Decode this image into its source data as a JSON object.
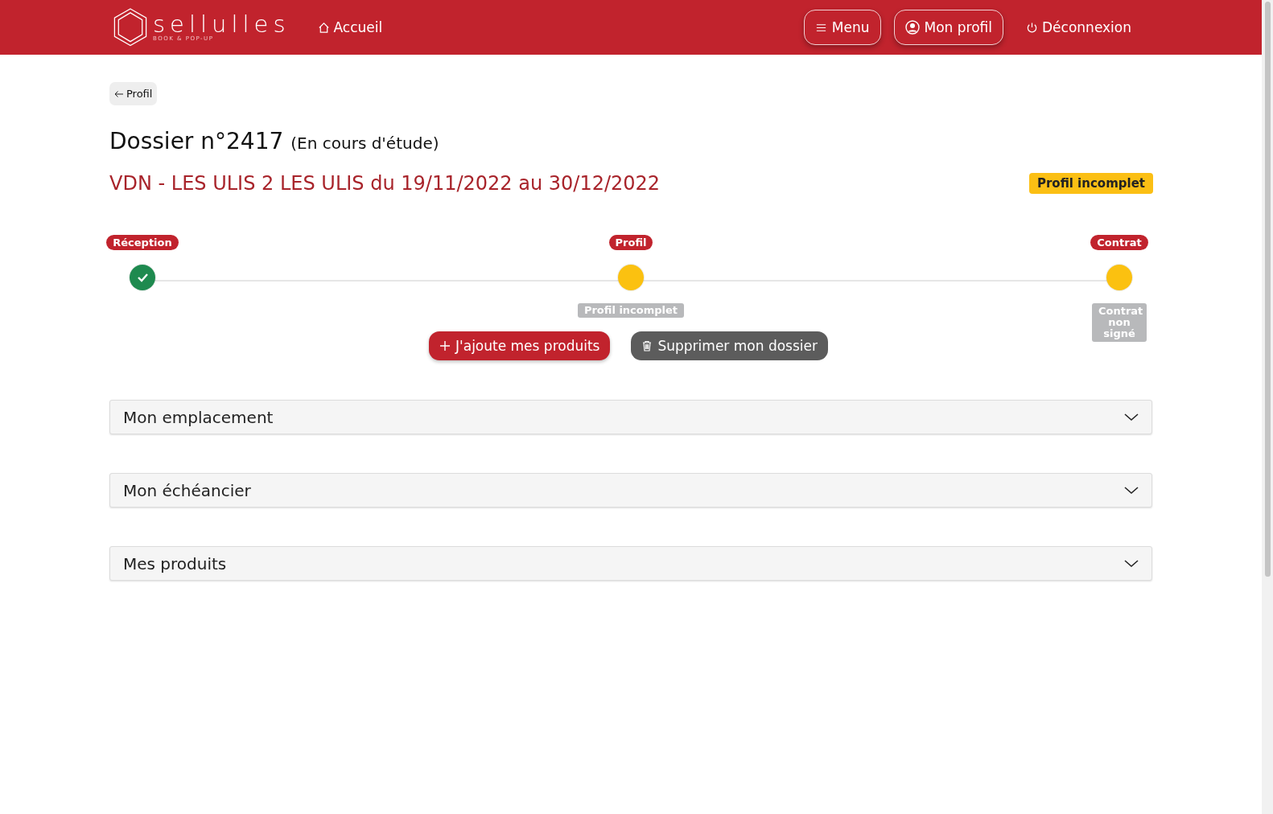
{
  "header": {
    "logo": {
      "name": "sellulles",
      "tagline": "BOOK & POP-UP"
    },
    "home_link": "Accueil",
    "nav_buttons": [
      {
        "label": "Menu",
        "kind": "menu"
      },
      {
        "label": "Mon profil",
        "kind": "profile"
      }
    ],
    "logout_link": "Déconnexion"
  },
  "back_button": "Profil",
  "title": {
    "main": "Dossier n°2417",
    "status": "(En cours d'étude)"
  },
  "subtitle": "VDN - LES ULIS 2 LES ULIS du 19/11/2022 au 30/12/2022",
  "status_badge": "Profil incomplet",
  "steps": [
    {
      "label": "Réception",
      "kind": "done"
    },
    {
      "label": "Profil",
      "kind": "pending",
      "caption": "Profil incomplet"
    },
    {
      "label": "Contrat",
      "kind": "pending",
      "caption": "Contrat non signé"
    }
  ],
  "actions": [
    {
      "label": "J'ajoute mes produits",
      "kind": "add"
    },
    {
      "label": "Supprimer mon dossier",
      "kind": "delete"
    }
  ],
  "sections": [
    {
      "title": "Mon emplacement",
      "expanded": false
    },
    {
      "title": "Mon échéancier",
      "expanded": false
    },
    {
      "title": "Mes produits",
      "expanded": false
    }
  ]
}
